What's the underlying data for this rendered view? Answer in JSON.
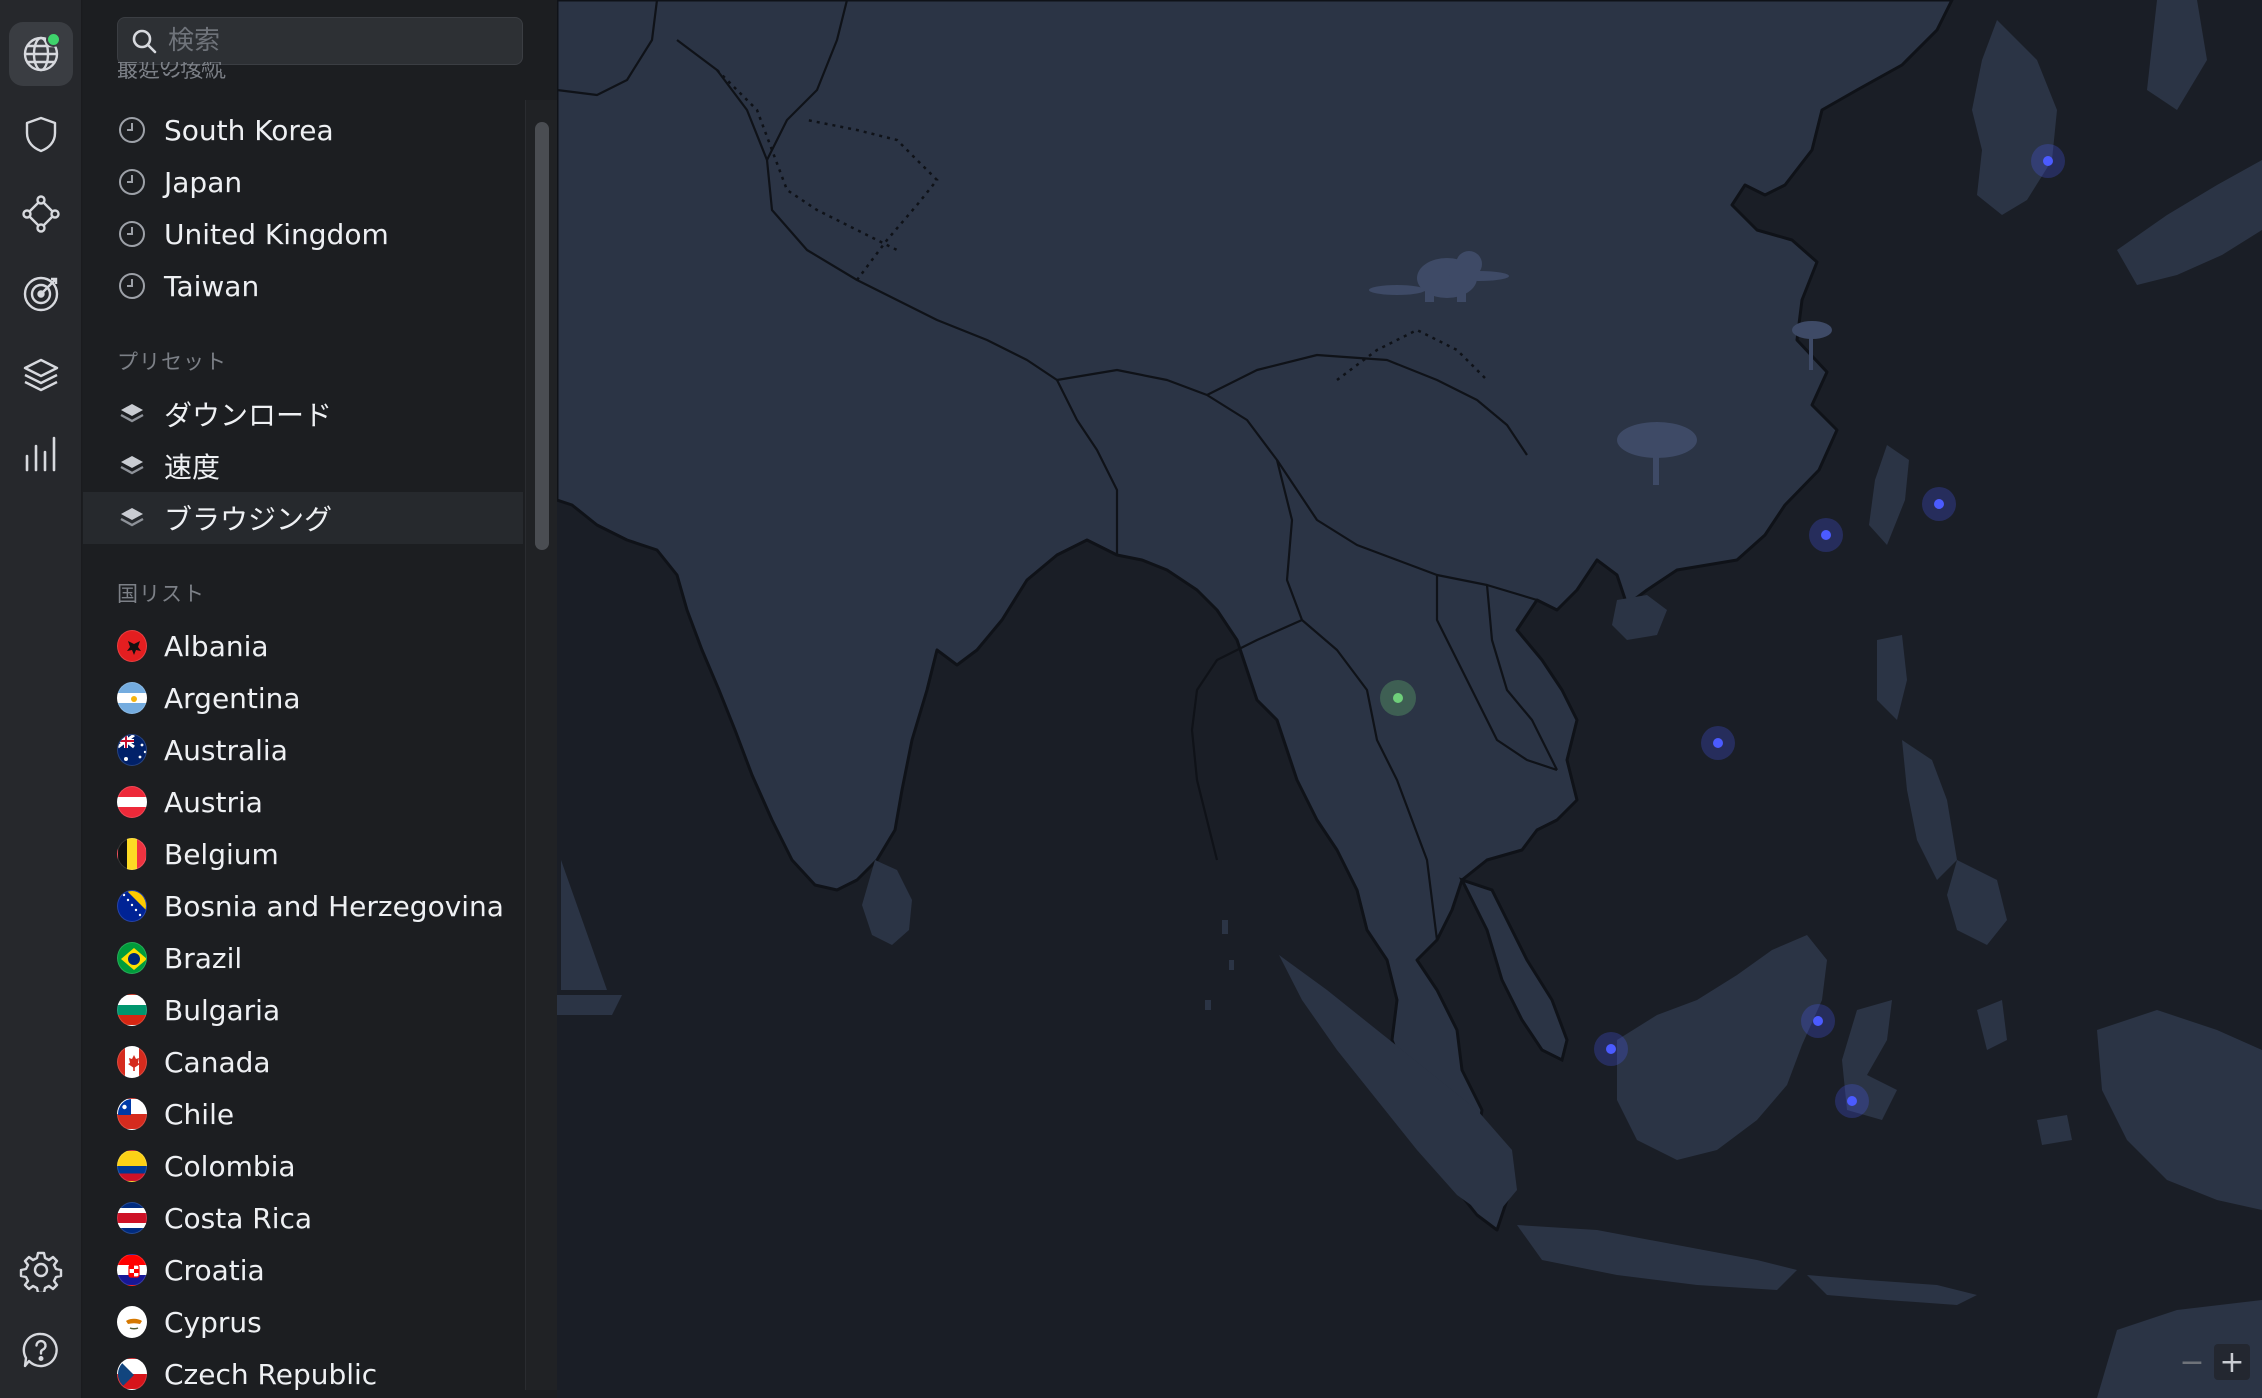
{
  "search": {
    "placeholder": "検索"
  },
  "recent": {
    "title": "最近の接続",
    "items": [
      {
        "label": "South Korea"
      },
      {
        "label": "Japan"
      },
      {
        "label": "United Kingdom"
      },
      {
        "label": "Taiwan"
      }
    ]
  },
  "presets": {
    "title": "プリセット",
    "items": [
      {
        "label": "ダウンロード"
      },
      {
        "label": "速度"
      },
      {
        "label": "ブラウジング"
      }
    ]
  },
  "countries": {
    "title": "国リスト",
    "items": [
      {
        "label": "Albania",
        "flag": "albania"
      },
      {
        "label": "Argentina",
        "flag": "argentina"
      },
      {
        "label": "Australia",
        "flag": "australia"
      },
      {
        "label": "Austria",
        "flag": "austria"
      },
      {
        "label": "Belgium",
        "flag": "belgium"
      },
      {
        "label": "Bosnia and Herzegovina",
        "flag": "bosnia"
      },
      {
        "label": "Brazil",
        "flag": "brazil"
      },
      {
        "label": "Bulgaria",
        "flag": "bulgaria"
      },
      {
        "label": "Canada",
        "flag": "canada"
      },
      {
        "label": "Chile",
        "flag": "chile"
      },
      {
        "label": "Colombia",
        "flag": "colombia"
      },
      {
        "label": "Costa Rica",
        "flag": "costa-rica"
      },
      {
        "label": "Croatia",
        "flag": "croatia"
      },
      {
        "label": "Cyprus",
        "flag": "cyprus"
      },
      {
        "label": "Czech Republic",
        "flag": "czech"
      }
    ]
  },
  "map": {
    "zoom_out": "−",
    "zoom_in": "+"
  },
  "colors": {
    "accent_green": "#3fd46c",
    "server_blue": "#4b5bff",
    "connected_green": "#6fcf7a",
    "land": "#2b3445",
    "ocean": "#1a1e26"
  }
}
